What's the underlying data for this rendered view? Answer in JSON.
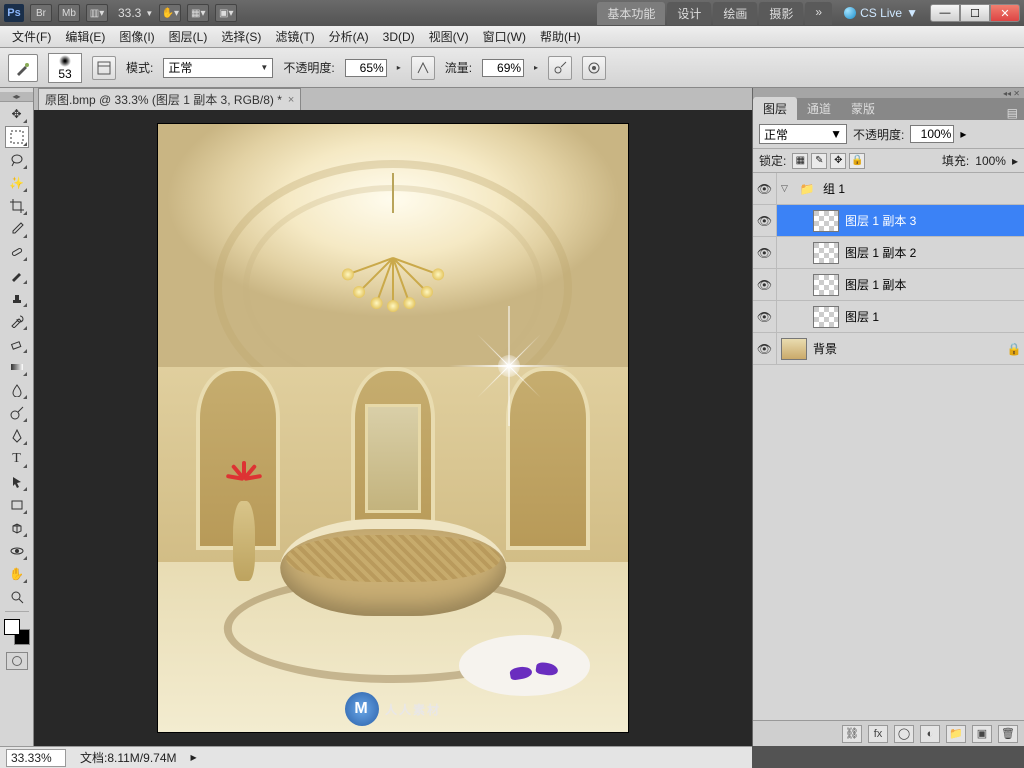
{
  "titlebar": {
    "zoom": "33.3",
    "workspaces": [
      "基本功能",
      "设计",
      "绘画",
      "摄影"
    ],
    "ws_more": "»",
    "cslive": "CS Live"
  },
  "menus": {
    "file": "文件(F)",
    "edit": "编辑(E)",
    "image": "图像(I)",
    "layer": "图层(L)",
    "select": "选择(S)",
    "filter": "滤镜(T)",
    "analysis": "分析(A)",
    "threeD": "3D(D)",
    "view": "视图(V)",
    "window": "窗口(W)",
    "help": "帮助(H)"
  },
  "options": {
    "brush_size": "53",
    "mode_label": "模式:",
    "mode_value": "正常",
    "opacity_label": "不透明度:",
    "opacity_value": "65%",
    "flow_label": "流量:",
    "flow_value": "69%"
  },
  "document": {
    "tab": "原图.bmp @ 33.3% (图层 1 副本 3, RGB/8) *"
  },
  "layers_panel": {
    "tabs": {
      "layers": "图层",
      "channels": "通道",
      "paths": "蒙版"
    },
    "blend_mode": "正常",
    "opacity_label": "不透明度:",
    "opacity_value": "100%",
    "lock_label": "锁定:",
    "fill_label": "填充:",
    "fill_value": "100%",
    "items": {
      "group": "组 1",
      "l3": "图层 1 副本 3",
      "l2": "图层 1 副本 2",
      "l1": "图层 1 副本",
      "l0": "图层 1",
      "bg": "背景"
    }
  },
  "status": {
    "zoom": "33.33%",
    "doc_label": "文档:",
    "doc_size": "8.11M/9.74M"
  },
  "watermark": "人人素材"
}
